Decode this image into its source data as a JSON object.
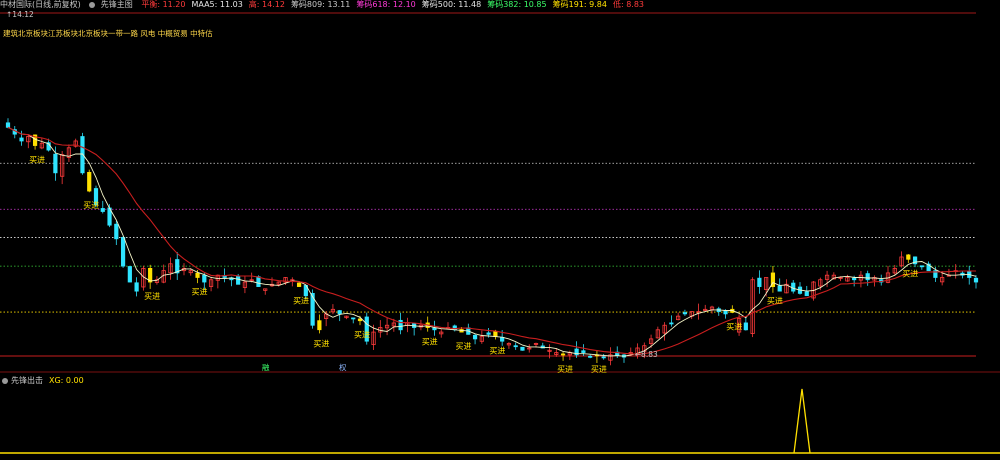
{
  "header": {
    "stock_title": "中材国际(日线,前复权)",
    "indicator_name": "先锋主图",
    "fields": [
      {
        "label": "平衡: 11.20",
        "color": "#ff3b3b"
      },
      {
        "label": "MAA5: 11.03",
        "color": "#e6e6e6"
      },
      {
        "label": "高: 14.12",
        "color": "#ff3b3b"
      },
      {
        "label": "筹码809: 13.11",
        "color": "#c8c8c8"
      },
      {
        "label": "筹码618: 12.10",
        "color": "#ff3bd8"
      },
      {
        "label": "筹码500: 11.48",
        "color": "#e6e6e6"
      },
      {
        "label": "筹码382: 10.85",
        "color": "#3bff6a"
      },
      {
        "label": "筹码191: 9.84",
        "color": "#ffe000"
      },
      {
        "label": "低: 8.83",
        "color": "#ff3b3b"
      }
    ]
  },
  "high_marker": "14.12",
  "low_marker": "8.83",
  "sector_tags": "建筑北京板块江苏板块北京板块一带一路 风电 中概贸易 中特估",
  "buy_signal_label": "买进",
  "sub_panel": {
    "name": "先锋出击",
    "readout": "XG: 0.00"
  },
  "event_markers": [
    {
      "text": "融",
      "color": "#3bff6a"
    },
    {
      "text": "权",
      "color": "#8fb8ff"
    }
  ],
  "colors": {
    "up": "#ff3b3b",
    "down": "#2fe4ff",
    "ma_short": "#f5f5c8",
    "ma_long": "#c81e1e",
    "signal": "#ffe000"
  },
  "chart_data": {
    "type": "candlestick",
    "price_range": [
      8.83,
      14.12
    ],
    "reference_levels": [
      {
        "name": "筹码809",
        "value": 13.11,
        "color": "#d6d6d6"
      },
      {
        "name": "筹码618",
        "value": 12.1,
        "color": "#d23bd2"
      },
      {
        "name": "筹码500",
        "value": 11.48,
        "color": "#e6e6e6"
      },
      {
        "name": "筹码382",
        "value": 10.85,
        "color": "#3bd23b"
      },
      {
        "name": "筹码191",
        "value": 9.84,
        "color": "#ffe000"
      }
    ],
    "close": [
      13.9,
      13.75,
      13.6,
      13.7,
      13.5,
      13.55,
      13.4,
      12.9,
      13.3,
      13.45,
      13.6,
      12.9,
      12.5,
      12.2,
      12.05,
      11.75,
      11.45,
      10.85,
      10.5,
      10.3,
      10.8,
      10.5,
      10.55,
      10.75,
      10.9,
      10.7,
      10.8,
      10.75,
      10.6,
      10.5,
      10.55,
      10.65,
      10.6,
      10.55,
      10.45,
      10.5,
      10.55,
      10.4,
      10.35,
      10.45,
      10.5,
      10.6,
      10.55,
      10.4,
      10.2,
      9.55,
      9.65,
      9.8,
      9.9,
      9.8,
      9.75,
      9.7,
      9.65,
      9.2,
      9.4,
      9.5,
      9.55,
      9.6,
      9.45,
      9.6,
      9.5,
      9.55,
      9.5,
      9.45,
      9.4,
      9.5,
      9.45,
      9.4,
      9.35,
      9.25,
      9.3,
      9.35,
      9.3,
      9.2,
      9.15,
      9.1,
      9.0,
      9.05,
      9.15,
      9.05,
      9.0,
      8.95,
      8.9,
      8.95,
      8.9,
      8.95,
      8.85,
      8.9,
      8.85,
      8.9,
      8.88,
      8.85,
      8.95,
      9.05,
      9.1,
      9.25,
      9.45,
      9.55,
      9.6,
      9.75,
      9.8,
      9.85,
      9.85,
      9.9,
      9.95,
      9.85,
      9.8,
      9.9,
      9.7,
      9.45,
      10.55,
      10.4,
      10.6,
      10.4,
      10.3,
      10.45,
      10.3,
      10.25,
      10.2,
      10.5,
      10.55,
      10.65,
      10.65,
      10.6,
      10.6,
      10.55,
      10.65,
      10.55,
      10.6,
      10.5,
      10.7,
      10.8,
      11.05,
      11.0,
      10.9,
      10.85,
      10.75,
      10.6,
      10.6,
      10.65,
      10.75,
      10.65,
      10.6,
      10.5
    ],
    "buy_signal_indices": [
      4,
      12,
      21,
      28,
      43,
      46,
      52,
      62,
      67,
      72,
      82,
      87,
      107,
      113,
      133
    ]
  }
}
